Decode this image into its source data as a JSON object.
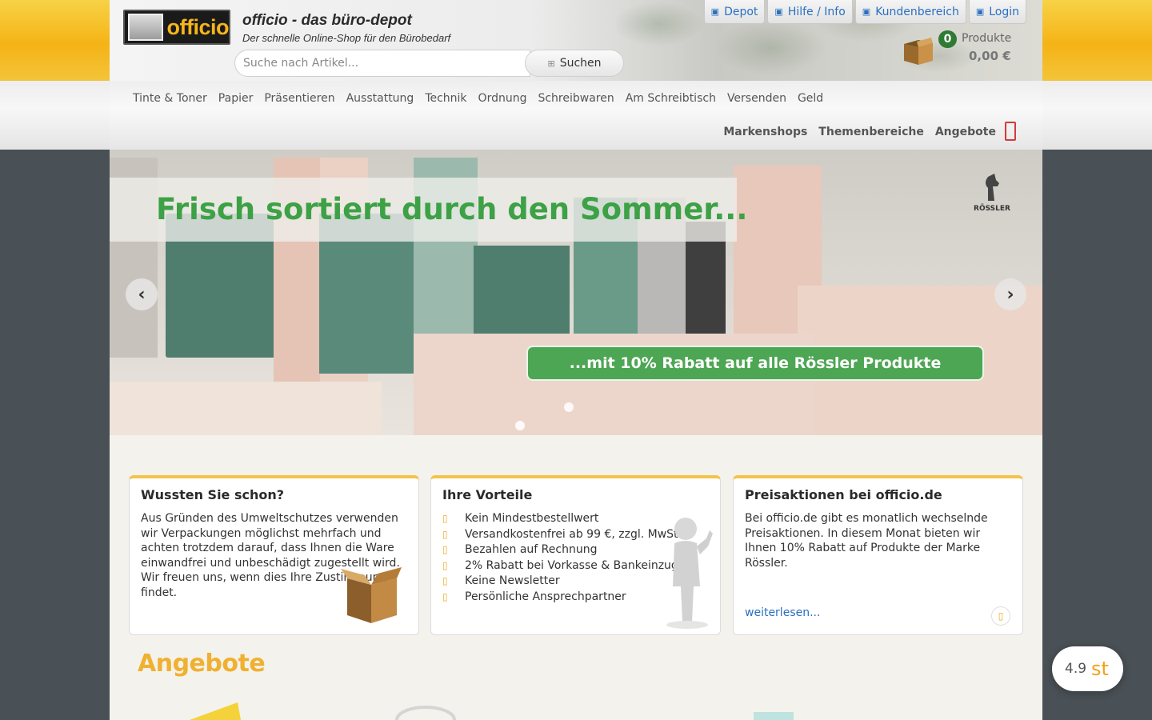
{
  "header": {
    "logo_text": "officio",
    "site_title": "officio - das büro-depot",
    "site_subtitle": "Der schnelle Online-Shop für den Bürobedarf",
    "search_placeholder": "Suche nach Artikel...",
    "search_button": "Suchen",
    "toplinks": [
      {
        "label": "Depot",
        "icon": "depot-icon"
      },
      {
        "label": "Hilfe / Info",
        "icon": "info-icon"
      },
      {
        "label": "Kundenbereich",
        "icon": "user-icon"
      },
      {
        "label": "Login",
        "icon": "login-icon"
      }
    ],
    "cart": {
      "count": "0",
      "label": "Produkte",
      "total": "0,00 €"
    }
  },
  "nav": {
    "categories": [
      "Tinte & Toner",
      "Papier",
      "Präsentieren",
      "Ausstattung",
      "Technik",
      "Ordnung",
      "Schreibwaren",
      "Am Schreibtisch",
      "Versenden",
      "Geld"
    ],
    "secondary": [
      "Markenshops",
      "Themenbereiche",
      "Angebote"
    ]
  },
  "slider": {
    "title": "Frisch sortiert durch den Sommer...",
    "pill": "...mit 10% Rabatt auf alle Rössler Produkte",
    "brand": "RÖSSLER",
    "prev": "‹",
    "next": "›"
  },
  "boxes": [
    {
      "title": "Wussten Sie schon?",
      "text": "Aus Gründen des Umweltschutzes verwenden wir Verpackungen möglichst mehrfach und achten trotzdem darauf, dass Ihnen die Ware einwandfrei und unbeschädigt zugestellt wird. Wir freuen uns, wenn dies Ihre Zustimmung findet."
    },
    {
      "title": "Ihre Vorteile",
      "items": [
        "Kein Mindestbestellwert",
        "Versandkostenfrei ab 99 €, zzgl. MwSt.",
        "Bezahlen auf Rechnung",
        "2% Rabatt bei Vorkasse & Bankeinzug",
        "Keine Newsletter",
        "Persönliche Ansprechpartner"
      ]
    },
    {
      "title": "Preisaktionen bei officio.de",
      "text": "Bei officio.de gibt es monatlich wechselnde Preisaktionen. In diesem Monat bieten wir Ihnen 10% Rabatt auf Produkte der Marke Rössler.",
      "link": "weiterlesen..."
    }
  ],
  "offers_title": "Angebote",
  "rating": {
    "score": "4.9",
    "stars": "st"
  },
  "colors": {
    "accent": "#f5b316",
    "green": "#3da145",
    "link": "#2a70c1"
  }
}
